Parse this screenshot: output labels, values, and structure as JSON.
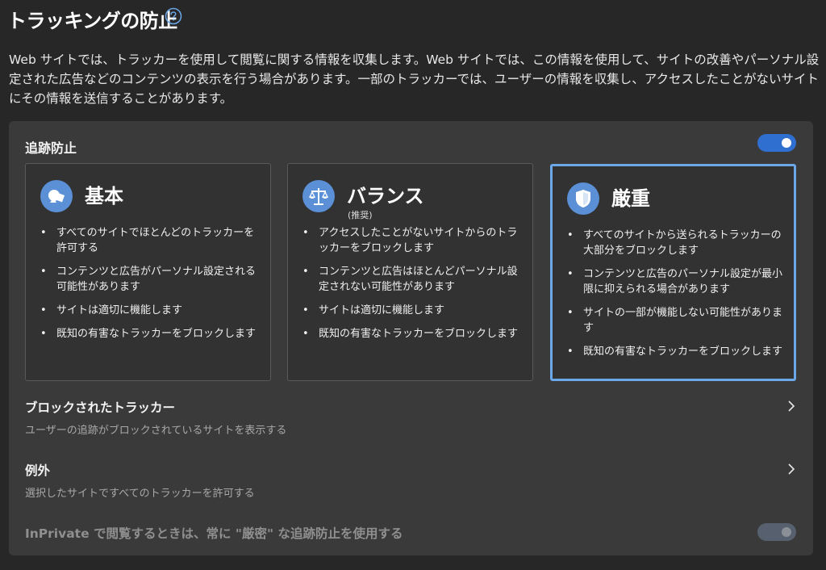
{
  "page": {
    "title": "トラッキングの防止",
    "help_icon": "question-circle-icon",
    "description": "Web サイトでは、トラッカーを使用して閲覧に関する情報を収集します。Web サイトでは、この情報を使用して、サイトの改善やパーソナル設定された広告などのコンテンツの表示を行う場合があります。一部のトラッカーでは、ユーザーの情報を収集し、アクセスしたことがないサイトにその情報を送信することがあります。"
  },
  "tracking_prevention": {
    "label": "追跡防止",
    "enabled": true
  },
  "cards": [
    {
      "name": "基本",
      "subtitle": "",
      "icon": "shapes-icon",
      "selected": false,
      "bullets": [
        "すべてのサイトでほとんどのトラッカーを許可する",
        "コンテンツと広告がパーソナル設定される可能性があります",
        "サイトは適切に機能します",
        "既知の有害なトラッカーをブロックします"
      ]
    },
    {
      "name": "バランス",
      "subtitle": "(推奨)",
      "icon": "scales-icon",
      "selected": false,
      "bullets": [
        "アクセスしたことがないサイトからのトラッカーをブロックします",
        "コンテンツと広告はほとんどパーソナル設定されない可能性があります",
        "サイトは適切に機能します",
        "既知の有害なトラッカーをブロックします"
      ]
    },
    {
      "name": "厳重",
      "subtitle": "",
      "icon": "shield-icon",
      "selected": true,
      "bullets": [
        "すべてのサイトから送られるトラッカーの大部分をブロックします",
        "コンテンツと広告のパーソナル設定が最小限に抑えられる場合があります",
        "サイトの一部が機能しない可能性があります",
        "既知の有害なトラッカーをブロックします"
      ]
    }
  ],
  "blocked_trackers": {
    "title": "ブロックされたトラッカー",
    "subtitle": "ユーザーの追跡がブロックされているサイトを表示する"
  },
  "exceptions": {
    "title": "例外",
    "subtitle": "選択したサイトですべてのトラッカーを許可する"
  },
  "inprivate": {
    "label": "InPrivate で閲覧するときは、常に \"厳密\" な追跡防止を使用する",
    "enabled": true,
    "disabled_state": true
  },
  "colors": {
    "background": "#272727",
    "panel": "#3a3a3a",
    "accent": "#2f6fd0",
    "selected_border": "#6aa8ea",
    "icon_bg": "#5b8fd6"
  }
}
